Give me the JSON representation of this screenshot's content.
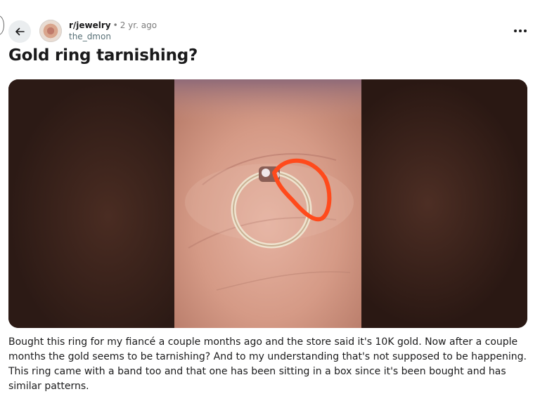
{
  "post": {
    "subreddit": "r/jewelry",
    "separator": "•",
    "age": "2 yr. ago",
    "author": "the_dmon",
    "title": "Gold ring tarnishing?",
    "body": "Bought this ring for my fiancé a couple months ago and the store said it's 10K gold. Now after a couple months the gold seems to be tarnishing? And to my understanding that's not supposed to be happening. This ring came with a band too and that one has been sitting in a box since it's been bought and has similar patterns."
  },
  "icons": {
    "back": "arrow-left-icon",
    "avatar": "subreddit-avatar",
    "more": "more-horizontal-icon"
  },
  "colors": {
    "text": "#1a1a1b",
    "muted": "#7c7c7c",
    "author": "#576f76",
    "button_bg": "#eaedef",
    "annotation": "#ff4a1c"
  }
}
